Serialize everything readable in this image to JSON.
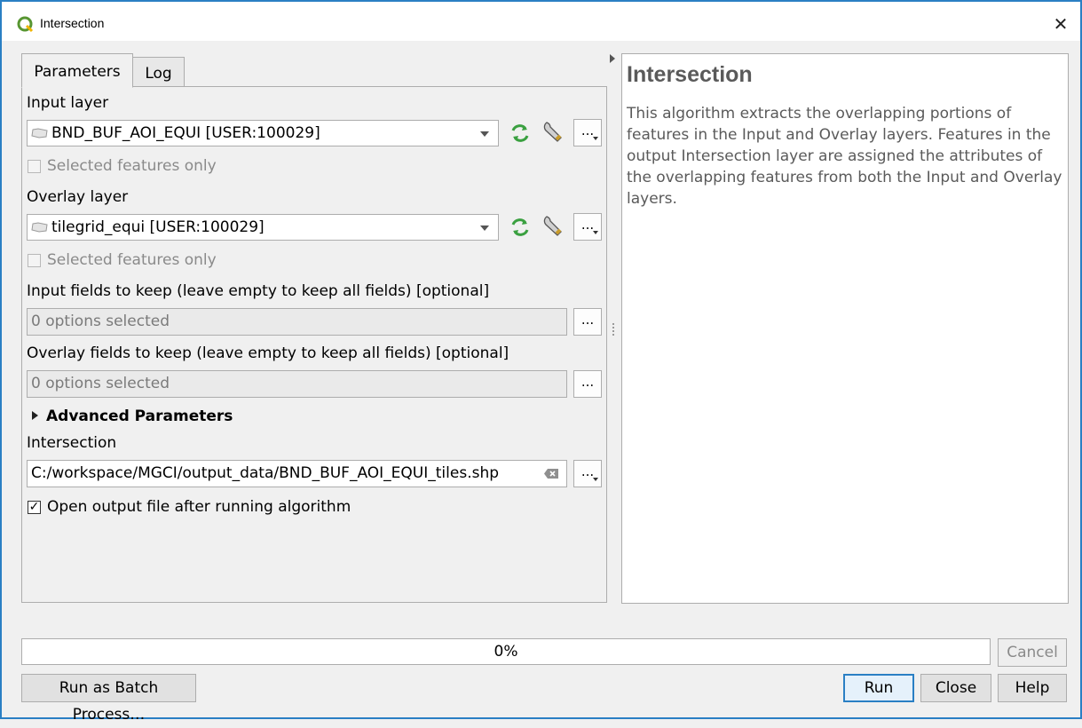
{
  "window": {
    "title": "Intersection",
    "close_symbol": "✕"
  },
  "tabs": [
    {
      "label": "Parameters",
      "active": true
    },
    {
      "label": "Log",
      "active": false
    }
  ],
  "params": {
    "input_layer": {
      "label": "Input layer",
      "value": "BND_BUF_AOI_EQUI [USER:100029]",
      "selected_only_label": "Selected features only",
      "selected_only_checked": false
    },
    "overlay_layer": {
      "label": "Overlay layer",
      "value": "tilegrid_equi [USER:100029]",
      "selected_only_label": "Selected features only",
      "selected_only_checked": false
    },
    "input_fields": {
      "label": "Input fields to keep (leave empty to keep all fields) [optional]",
      "value": "0 options selected"
    },
    "overlay_fields": {
      "label": "Overlay fields to keep (leave empty to keep all fields) [optional]",
      "value": "0 options selected"
    },
    "advanced_label": "Advanced Parameters",
    "output": {
      "label": "Intersection",
      "value": "C:/workspace/MGCI/output_data/BND_BUF_AOI_EQUI_tiles.shp"
    },
    "open_output": {
      "label": "Open output file after running algorithm",
      "checked": true,
      "check_symbol": "✓"
    },
    "dots_label": "..."
  },
  "help": {
    "title": "Intersection",
    "body": "This algorithm extracts the overlapping portions of features in the Input and Overlay layers. Features in the output Intersection layer are assigned the attributes of the overlapping features from both the Input and Overlay layers."
  },
  "progress": {
    "text": "0%",
    "value": 0
  },
  "buttons": {
    "cancel": "Cancel",
    "batch": "Run as Batch Process…",
    "run": "Run",
    "close": "Close",
    "help": "Help"
  },
  "colors": {
    "accent": "#2a7fc4",
    "iterate_icon": "#3aa040",
    "qgis_logo": "#589632"
  }
}
